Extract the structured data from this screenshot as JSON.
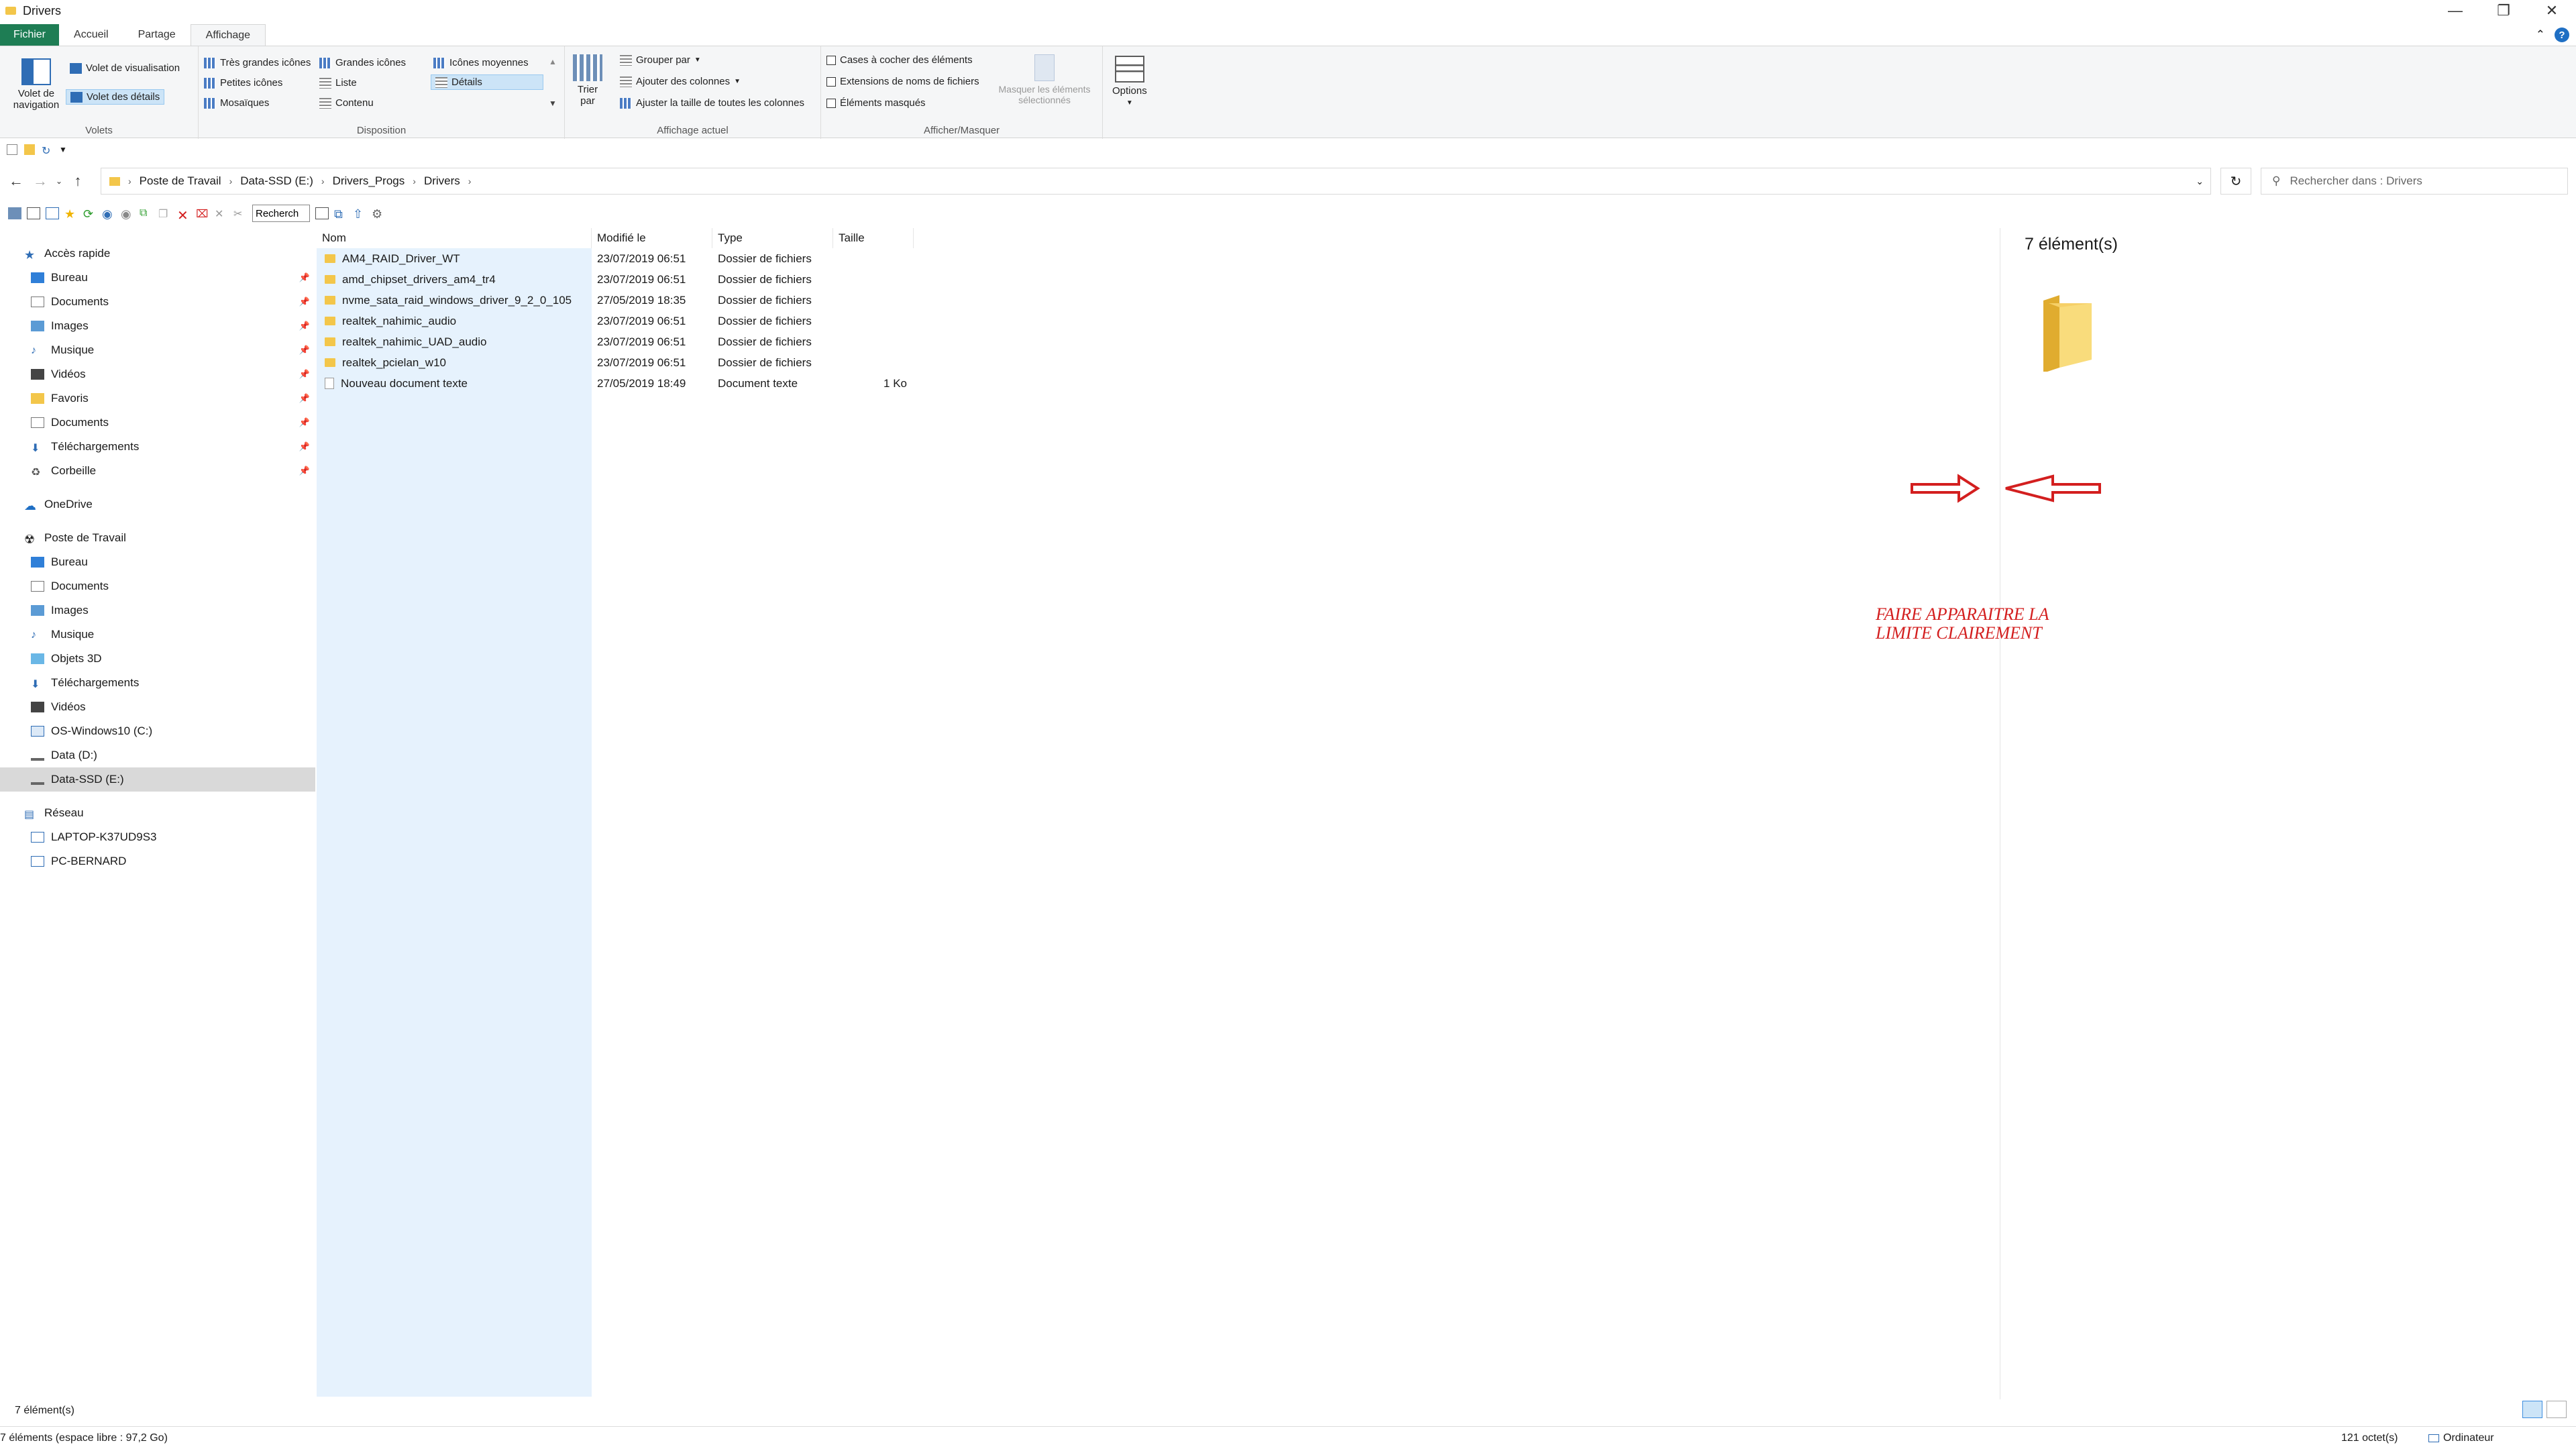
{
  "window": {
    "title": "Drivers"
  },
  "tabs": [
    "Fichier",
    "Accueil",
    "Partage",
    "Affichage"
  ],
  "ribbon": {
    "volets": {
      "nav_pane_label": "Volet de navigation",
      "preview_pane": "Volet de visualisation",
      "details_pane": "Volet des détails",
      "group_label": "Volets"
    },
    "disposition": {
      "items": [
        "Très grandes icônes",
        "Grandes icônes",
        "Icônes moyennes",
        "Petites icônes",
        "Liste",
        "Détails",
        "Mosaïques",
        "Contenu"
      ],
      "group_label": "Disposition"
    },
    "affichage_actuel": {
      "sort_label": "Trier par",
      "group_by": "Grouper par",
      "add_columns": "Ajouter des colonnes",
      "fit_columns": "Ajuster la taille de toutes les colonnes",
      "group_label": "Affichage actuel"
    },
    "afficher_masquer": {
      "checkboxes": "Cases à cocher des éléments",
      "extensions": "Extensions de noms de fichiers",
      "hidden": "Éléments masqués",
      "hide_selected": "Masquer les éléments sélectionnés",
      "group_label": "Afficher/Masquer"
    },
    "options_label": "Options"
  },
  "address": {
    "crumbs": [
      "Poste de Travail",
      "Data-SSD (E:)",
      "Drivers_Progs",
      "Drivers"
    ],
    "search_placeholder": "Rechercher dans : Drivers"
  },
  "toolbar2": {
    "search_value": "Recherch"
  },
  "nav": {
    "quick_access": "Accès rapide",
    "quick_items": [
      "Bureau",
      "Documents",
      "Images",
      "Musique",
      "Vidéos",
      "Favoris",
      "Documents",
      "Téléchargements",
      "Corbeille"
    ],
    "onedrive": "OneDrive",
    "this_pc": "Poste de Travail",
    "pc_items": [
      "Bureau",
      "Documents",
      "Images",
      "Musique",
      "Objets 3D",
      "Téléchargements",
      "Vidéos",
      "OS-Windows10 (C:)",
      "Data (D:)",
      "Data-SSD (E:)"
    ],
    "network": "Réseau",
    "network_items": [
      "LAPTOP-K37UD9S3",
      "PC-BERNARD"
    ]
  },
  "columns": {
    "name": "Nom",
    "modified": "Modifié le",
    "type": "Type",
    "size": "Taille"
  },
  "files": [
    {
      "name": "AM4_RAID_Driver_WT",
      "modified": "23/07/2019 06:51",
      "type": "Dossier de fichiers",
      "size": ""
    },
    {
      "name": "amd_chipset_drivers_am4_tr4",
      "modified": "23/07/2019 06:51",
      "type": "Dossier de fichiers",
      "size": ""
    },
    {
      "name": "nvme_sata_raid_windows_driver_9_2_0_105",
      "modified": "27/05/2019 18:35",
      "type": "Dossier de fichiers",
      "size": ""
    },
    {
      "name": "realtek_nahimic_audio",
      "modified": "23/07/2019 06:51",
      "type": "Dossier de fichiers",
      "size": ""
    },
    {
      "name": "realtek_nahimic_UAD_audio",
      "modified": "23/07/2019 06:51",
      "type": "Dossier de fichiers",
      "size": ""
    },
    {
      "name": "realtek_pcielan_w10",
      "modified": "23/07/2019 06:51",
      "type": "Dossier de fichiers",
      "size": ""
    },
    {
      "name": "Nouveau document texte",
      "modified": "27/05/2019 18:49",
      "type": "Document texte",
      "size": "1 Ko"
    }
  ],
  "preview": {
    "count": "7 élément(s)"
  },
  "annotation": {
    "line1": "FAIRE APPARAITRE LA",
    "line2": "LIMITE CLAIREMENT"
  },
  "status": {
    "count": "7 élément(s)",
    "bottom_left": "7 éléments (espace libre : 97,2 Go)",
    "bottom_size": "121 octet(s)",
    "bottom_location": "Ordinateur"
  },
  "colors": {
    "file_tab": "#1e7d54",
    "folder": "#f3c64a",
    "selection": "#e6f2fd",
    "annotation": "#d31f1f"
  }
}
